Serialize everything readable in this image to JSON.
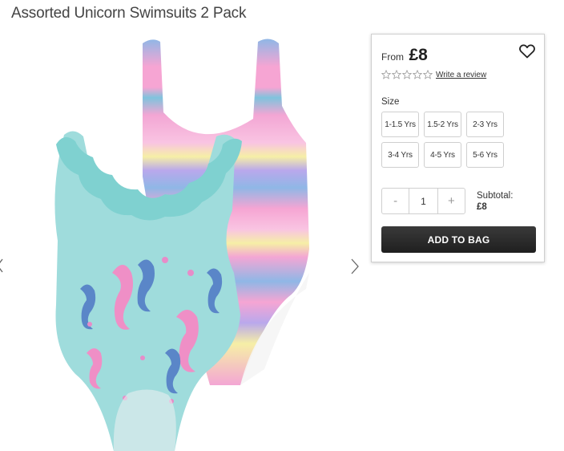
{
  "product": {
    "title": "Assorted Unicorn Swimsuits 2 Pack",
    "price_prefix": "From",
    "price": "£8",
    "rating_stars": 0,
    "write_review": "Write a review",
    "size_label": "Size",
    "sizes": [
      "1-1.5 Yrs",
      "1.5-2 Yrs",
      "2-3 Yrs",
      "3-4 Yrs",
      "4-5 Yrs",
      "5-6 Yrs"
    ],
    "quantity": "1",
    "qty_minus": "-",
    "qty_plus": "+",
    "subtotal_label": "Subtotal:",
    "subtotal_value": "£8",
    "add_to_bag": "ADD TO BAG"
  },
  "colors": {
    "button_dark": "#2a2a2a",
    "border": "#cfcfcf",
    "swimsuit_aqua": "#9fdcdc",
    "stripe_pink": "#f3a6d4",
    "stripe_blue": "#8fb7e6",
    "stripe_lilac": "#b9a8ec",
    "stripe_yellow": "#f6efa6"
  },
  "icons": {
    "wishlist": "heart-outline-icon",
    "gallery_prev": "chevron-left-icon",
    "gallery_next": "chevron-right-icon",
    "rating": "star-outline-icon"
  }
}
